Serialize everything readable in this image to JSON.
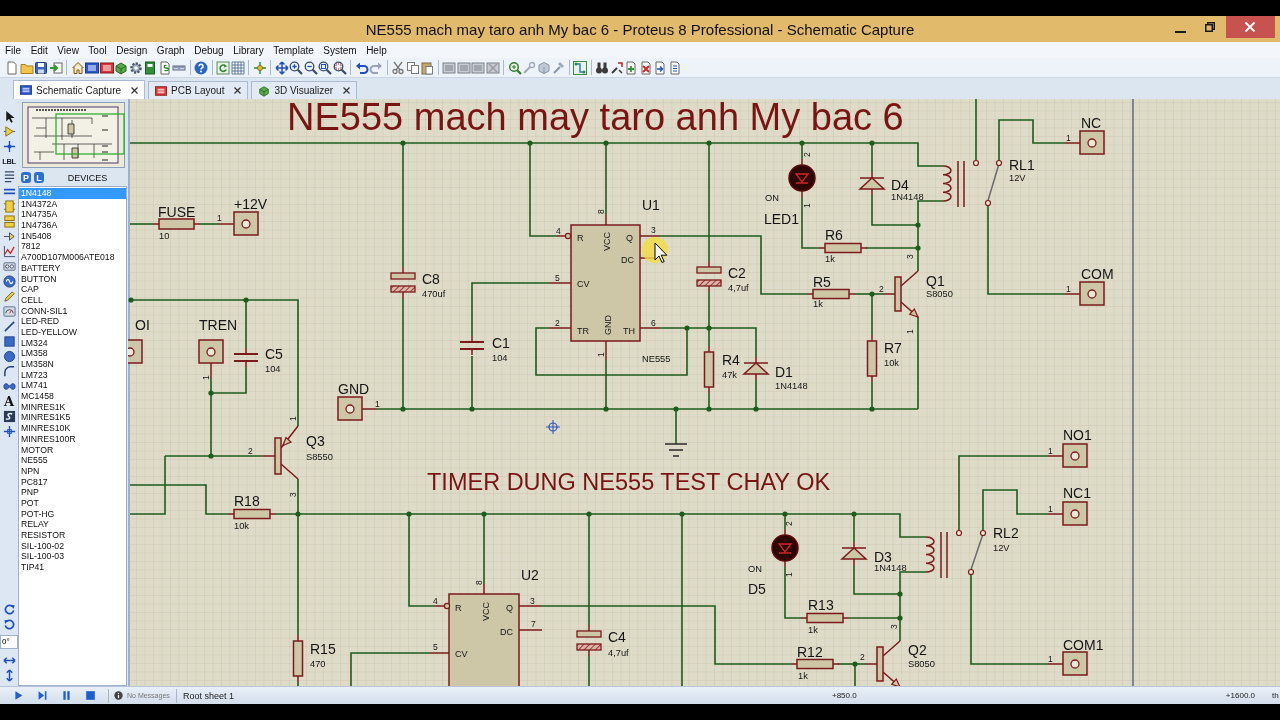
{
  "window": {
    "title": "NE555 mach may taro anh My bac 6 - Proteus 8 Professional - Schematic Capture"
  },
  "menu": [
    "File",
    "Edit",
    "View",
    "Tool",
    "Design",
    "Graph",
    "Debug",
    "Library",
    "Template",
    "System",
    "Help"
  ],
  "tabs": [
    {
      "label": "Schematic Capture",
      "selected": true
    },
    {
      "label": "PCB Layout",
      "selected": false
    },
    {
      "label": "3D Visualizer",
      "selected": false
    }
  ],
  "mode_toolbar": {
    "label_tool": "LBL",
    "text_tool": "A",
    "rotation": "0°"
  },
  "device_selector": {
    "buttons": [
      "P",
      "L"
    ],
    "title": "DEVICES",
    "items": [
      {
        "label": "1N4148",
        "selected": true
      },
      {
        "label": "1N4372A",
        "selected": false
      },
      {
        "label": "1N4735A",
        "selected": false
      },
      {
        "label": "1N4736A",
        "selected": false
      },
      {
        "label": "1N5408",
        "selected": false
      },
      {
        "label": "7812",
        "selected": false
      },
      {
        "label": "A700D107M006ATE018",
        "selected": false
      },
      {
        "label": "BATTERY",
        "selected": false
      },
      {
        "label": "BUTTON",
        "selected": false
      },
      {
        "label": "CAP",
        "selected": false
      },
      {
        "label": "CELL",
        "selected": false
      },
      {
        "label": "CONN-SIL1",
        "selected": false
      },
      {
        "label": "LED-RED",
        "selected": false
      },
      {
        "label": "LED-YELLOW",
        "selected": false
      },
      {
        "label": "LM324",
        "selected": false
      },
      {
        "label": "LM358",
        "selected": false
      },
      {
        "label": "LM358N",
        "selected": false
      },
      {
        "label": "LM723",
        "selected": false
      },
      {
        "label": "LM741",
        "selected": false
      },
      {
        "label": "MC1458",
        "selected": false
      },
      {
        "label": "MINRES1K",
        "selected": false
      },
      {
        "label": "MINRES1K5",
        "selected": false
      },
      {
        "label": "MINRES10K",
        "selected": false
      },
      {
        "label": "MINRES100R",
        "selected": false
      },
      {
        "label": "MOTOR",
        "selected": false
      },
      {
        "label": "NE555",
        "selected": false
      },
      {
        "label": "NPN",
        "selected": false
      },
      {
        "label": "PC817",
        "selected": false
      },
      {
        "label": "PNP",
        "selected": false
      },
      {
        "label": "POT",
        "selected": false
      },
      {
        "label": "POT-HG",
        "selected": false
      },
      {
        "label": "RELAY",
        "selected": false
      },
      {
        "label": "RESISTOR",
        "selected": false
      },
      {
        "label": "SIL-100-02",
        "selected": false
      },
      {
        "label": "SIL-100-03",
        "selected": false
      },
      {
        "label": "TIP41",
        "selected": false
      }
    ]
  },
  "schematic": {
    "title": "NE555 mach may taro anh My bac 6",
    "caption": "TIMER DUNG NE555 TEST CHAY OK",
    "components": [
      {
        "kind": "fuse",
        "ref": "FUSE",
        "value": "10"
      },
      {
        "kind": "terminal",
        "ref": "+12V",
        "pins": [
          "1"
        ]
      },
      {
        "kind": "electrolytic",
        "ref": "C8",
        "value": "470uf"
      },
      {
        "kind": "timer",
        "ref": "U1",
        "value": "NE555",
        "pins": [
          {
            "number": "4",
            "name": "R"
          },
          {
            "number": "8",
            "name": "VCC"
          },
          {
            "number": "3",
            "name": "Q"
          },
          {
            "name": "DC"
          },
          {
            "number": "5",
            "name": "CV"
          },
          {
            "number": "2",
            "name": "TR"
          },
          {
            "number": "1",
            "name": "GND"
          },
          {
            "number": "6",
            "name": "TH"
          }
        ]
      },
      {
        "kind": "led",
        "ref": "LED1",
        "value": "ON",
        "pins": [
          "2",
          "1"
        ]
      },
      {
        "kind": "diode",
        "ref": "D4",
        "value": "1N4148"
      },
      {
        "kind": "relay",
        "ref": "RL1",
        "value": "12V"
      },
      {
        "kind": "terminal",
        "ref": "NC",
        "pins": [
          "1"
        ]
      },
      {
        "kind": "resistor",
        "ref": "R6",
        "value": "1k"
      },
      {
        "kind": "electrolytic",
        "ref": "C2",
        "value": "4,7uf"
      },
      {
        "kind": "resistor",
        "ref": "R5",
        "value": "1k"
      },
      {
        "kind": "npn",
        "ref": "Q1",
        "value": "S8050",
        "pins": [
          "2",
          "3",
          "1"
        ]
      },
      {
        "kind": "terminal",
        "ref": "COM",
        "pins": [
          "1"
        ]
      },
      {
        "kind": "terminal",
        "ref": "OI"
      },
      {
        "kind": "terminal",
        "ref": "TREN",
        "pins": [
          "1"
        ]
      },
      {
        "kind": "capacitor",
        "ref": "C5",
        "value": "104"
      },
      {
        "kind": "capacitor",
        "ref": "C1",
        "value": "104"
      },
      {
        "kind": "resistor",
        "ref": "R4",
        "value": "47k"
      },
      {
        "kind": "diode",
        "ref": "D1",
        "value": "1N4148"
      },
      {
        "kind": "resistor",
        "ref": "R7",
        "value": "10k"
      },
      {
        "kind": "terminal",
        "ref": "GND",
        "pins": [
          "1"
        ]
      },
      {
        "kind": "ground"
      },
      {
        "kind": "pnp",
        "ref": "Q3",
        "value": "S8550",
        "pins": [
          "2",
          "3",
          "1"
        ]
      },
      {
        "kind": "terminal",
        "ref": "NO1",
        "pins": [
          "1"
        ]
      },
      {
        "kind": "resistor",
        "ref": "R18",
        "value": "10k"
      },
      {
        "kind": "terminal",
        "ref": "NC1",
        "pins": [
          "1"
        ]
      },
      {
        "kind": "led",
        "ref": "D5",
        "value": "ON",
        "pins": [
          "2",
          "1"
        ]
      },
      {
        "kind": "diode",
        "ref": "D3",
        "value": "1N4148"
      },
      {
        "kind": "relay",
        "ref": "RL2",
        "value": "12V"
      },
      {
        "kind": "timer",
        "ref": "U2",
        "pins": [
          {
            "number": "4",
            "name": "R"
          },
          {
            "number": "8",
            "name": "VCC"
          },
          {
            "number": "3",
            "name": "Q"
          },
          {
            "number": "7",
            "name": "DC"
          },
          {
            "number": "5",
            "name": "CV"
          }
        ]
      },
      {
        "kind": "electrolytic",
        "ref": "C4",
        "value": "4,7uf"
      },
      {
        "kind": "resistor",
        "ref": "R13",
        "value": "1k"
      },
      {
        "kind": "resistor",
        "ref": "R15",
        "value": "470"
      },
      {
        "kind": "resistor",
        "ref": "R12",
        "value": "1k"
      },
      {
        "kind": "npn",
        "ref": "Q2",
        "value": "S8050",
        "pins": [
          "2",
          "3"
        ]
      },
      {
        "kind": "terminal",
        "ref": "COM1",
        "pins": [
          "1"
        ]
      }
    ]
  },
  "status_bar": {
    "messages": "No Messages",
    "sheet": "Root sheet 1",
    "x": "+850.0",
    "y": "+1600.0",
    "unit": "th"
  }
}
